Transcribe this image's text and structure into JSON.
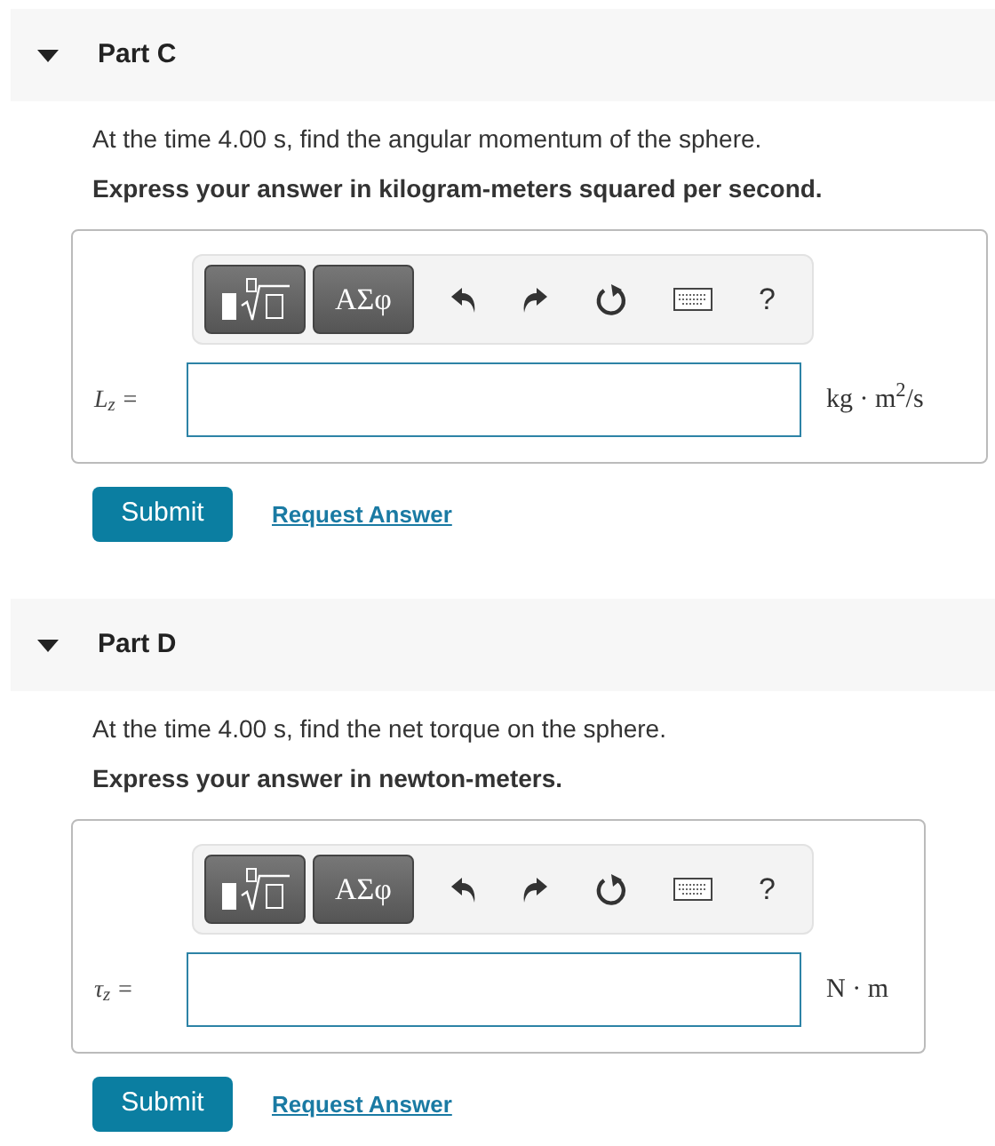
{
  "parts": [
    {
      "title": "Part C",
      "expanded": true,
      "question": "At the time 4.00 s, find the angular momentum of the sphere.",
      "instruction": "Express your answer in kilogram-meters squared per second.",
      "toolbar": {
        "symbols_button": "ΑΣφ",
        "help": "?"
      },
      "variable": "L$_{z}$ =",
      "units": "kg · m$^{2}$/s",
      "submit": "Submit",
      "request": "Request Answer"
    },
    {
      "title": "Part D",
      "expanded": true,
      "question": "At the time 4.00 s, find the net torque on the sphere.",
      "instruction": "Express your answer in newton-meters.",
      "toolbar": {
        "symbols_button": "ΑΣφ",
        "help": "?"
      },
      "variable": "τ$_{z}$ =",
      "units": "N · m",
      "submit": "Submit",
      "request": "Request Answer"
    }
  ]
}
